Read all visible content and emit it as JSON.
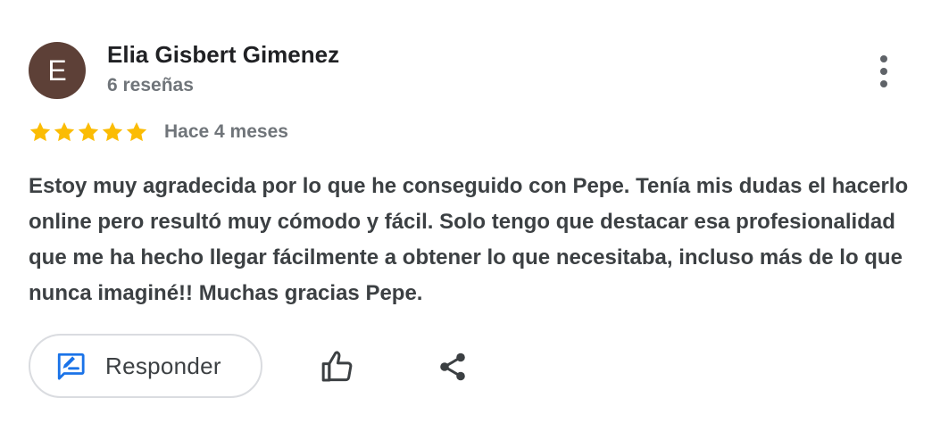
{
  "review": {
    "author": {
      "initial": "E",
      "name": "Elia Gisbert Gimenez",
      "meta": "6 reseñas",
      "avatar_color": "#5d4037"
    },
    "rating": 5,
    "rating_max": 5,
    "star_color": "#fbbc04",
    "date": "Hace 4 meses",
    "text": "Estoy muy agradecida por lo que he conseguido con Pepe. Tenía mis dudas el hacerlo online pero resultó muy cómodo y fácil. Solo tengo que destacar esa profesionalidad que me ha hecho llegar fácilmente a obtener lo que necesitaba, incluso más de lo que nunca imaginé!! Muchas gracias Pepe."
  },
  "actions": {
    "reply_label": "Responder",
    "reply_icon": "edit-reply-icon",
    "like_icon": "thumb-up-icon",
    "share_icon": "share-icon",
    "more_icon": "more-vert-icon",
    "accent_color": "#1a73e8"
  }
}
